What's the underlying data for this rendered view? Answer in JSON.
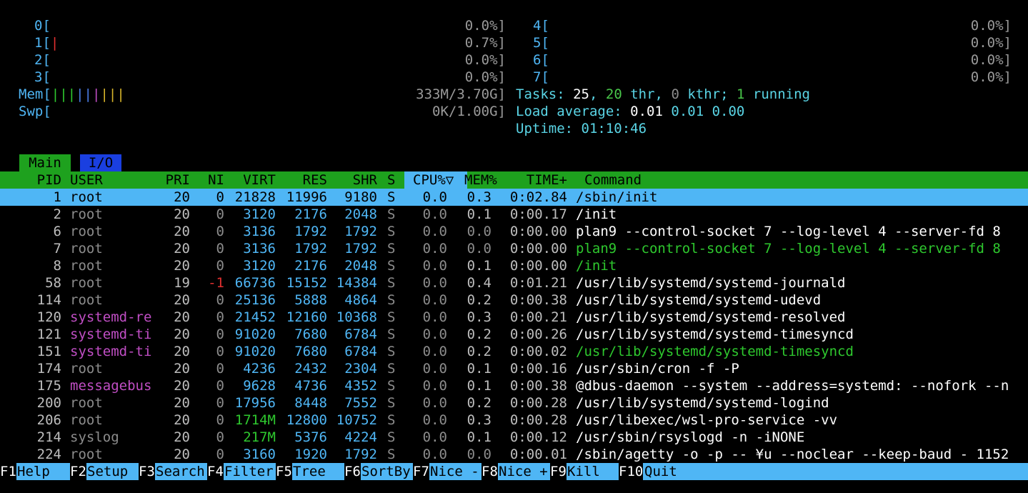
{
  "cpus": [
    {
      "id": "0",
      "value": "0.0%]"
    },
    {
      "id": "1",
      "value": "0.7%]"
    },
    {
      "id": "2",
      "value": "0.0%]"
    },
    {
      "id": "3",
      "value": "0.0%]"
    },
    {
      "id": "4",
      "value": "0.0%]"
    },
    {
      "id": "5",
      "value": "0.0%]"
    },
    {
      "id": "6",
      "value": "0.0%]"
    },
    {
      "id": "7",
      "value": "0.0%]"
    }
  ],
  "mem": {
    "label": "Mem",
    "value": "333M/3.70G]"
  },
  "swp": {
    "label": "Swp",
    "value": "0K/1.00G]"
  },
  "tasks": {
    "label": "Tasks:",
    "count": "25",
    "thr": "20",
    "thr_label": "thr,",
    "kthr": "0",
    "kthr_label": "kthr;",
    "running": "1",
    "running_label": "running"
  },
  "load": {
    "label": "Load average:",
    "v1": "0.01",
    "v2": "0.01",
    "v3": "0.00"
  },
  "uptime": {
    "label": "Uptime:",
    "value": "01:10:46"
  },
  "tabs": {
    "main": "Main",
    "io": "I/O"
  },
  "columns": {
    "pid": "PID",
    "user": "USER",
    "pri": "PRI",
    "ni": "NI",
    "virt": "VIRT",
    "res": "RES",
    "shr": "SHR",
    "s": "S",
    "cpu": "CPU%▽",
    "mem": "MEM%",
    "time": "TIME+",
    "command": "Command"
  },
  "processes": [
    {
      "pid": "1",
      "user": "root",
      "pri": "20",
      "ni": "0",
      "virt": "21828",
      "res": "11996",
      "shr": "9180",
      "s": "S",
      "cpu": "0.0",
      "mem": "0.3",
      "time": "0:02.84",
      "command": "/sbin/init"
    },
    {
      "pid": "2",
      "user": "root",
      "pri": "20",
      "ni": "0",
      "virt": "3120",
      "res": "2176",
      "shr": "2048",
      "s": "S",
      "cpu": "0.0",
      "mem": "0.1",
      "time": "0:00.17",
      "command": "/init"
    },
    {
      "pid": "6",
      "user": "root",
      "pri": "20",
      "ni": "0",
      "virt": "3136",
      "res": "1792",
      "shr": "1792",
      "s": "S",
      "cpu": "0.0",
      "mem": "0.0",
      "time": "0:00.00",
      "command": "plan9 --control-socket 7 --log-level 4 --server-fd 8"
    },
    {
      "pid": "7",
      "user": "root",
      "pri": "20",
      "ni": "0",
      "virt": "3136",
      "res": "1792",
      "shr": "1792",
      "s": "S",
      "cpu": "0.0",
      "mem": "0.0",
      "time": "0:00.00",
      "command": "plan9 --control-socket 7 --log-level 4 --server-fd 8"
    },
    {
      "pid": "8",
      "user": "root",
      "pri": "20",
      "ni": "0",
      "virt": "3120",
      "res": "2176",
      "shr": "2048",
      "s": "S",
      "cpu": "0.0",
      "mem": "0.1",
      "time": "0:00.00",
      "command": "/init"
    },
    {
      "pid": "58",
      "user": "root",
      "pri": "19",
      "ni": "-1",
      "virt": "66736",
      "res": "15152",
      "shr": "14384",
      "s": "S",
      "cpu": "0.0",
      "mem": "0.4",
      "time": "0:01.21",
      "command": "/usr/lib/systemd/systemd-journald"
    },
    {
      "pid": "114",
      "user": "root",
      "pri": "20",
      "ni": "0",
      "virt": "25136",
      "res": "5888",
      "shr": "4864",
      "s": "S",
      "cpu": "0.0",
      "mem": "0.2",
      "time": "0:00.38",
      "command": "/usr/lib/systemd/systemd-udevd"
    },
    {
      "pid": "120",
      "user": "systemd-re",
      "pri": "20",
      "ni": "0",
      "virt": "21452",
      "res": "12160",
      "shr": "10368",
      "s": "S",
      "cpu": "0.0",
      "mem": "0.3",
      "time": "0:00.21",
      "command": "/usr/lib/systemd/systemd-resolved"
    },
    {
      "pid": "121",
      "user": "systemd-ti",
      "pri": "20",
      "ni": "0",
      "virt": "91020",
      "res": "7680",
      "shr": "6784",
      "s": "S",
      "cpu": "0.0",
      "mem": "0.2",
      "time": "0:00.26",
      "command": "/usr/lib/systemd/systemd-timesyncd"
    },
    {
      "pid": "151",
      "user": "systemd-ti",
      "pri": "20",
      "ni": "0",
      "virt": "91020",
      "res": "7680",
      "shr": "6784",
      "s": "S",
      "cpu": "0.0",
      "mem": "0.2",
      "time": "0:00.02",
      "command": "/usr/lib/systemd/systemd-timesyncd"
    },
    {
      "pid": "174",
      "user": "root",
      "pri": "20",
      "ni": "0",
      "virt": "4236",
      "res": "2432",
      "shr": "2304",
      "s": "S",
      "cpu": "0.0",
      "mem": "0.1",
      "time": "0:00.16",
      "command": "/usr/sbin/cron -f -P"
    },
    {
      "pid": "175",
      "user": "messagebus",
      "pri": "20",
      "ni": "0",
      "virt": "9628",
      "res": "4736",
      "shr": "4352",
      "s": "S",
      "cpu": "0.0",
      "mem": "0.1",
      "time": "0:00.38",
      "command": "@dbus-daemon --system --address=systemd: --nofork --n"
    },
    {
      "pid": "200",
      "user": "root",
      "pri": "20",
      "ni": "0",
      "virt": "17956",
      "res": "8448",
      "shr": "7552",
      "s": "S",
      "cpu": "0.0",
      "mem": "0.2",
      "time": "0:00.28",
      "command": "/usr/lib/systemd/systemd-logind"
    },
    {
      "pid": "206",
      "user": "root",
      "pri": "20",
      "ni": "0",
      "virt": "1714M",
      "res": "12800",
      "shr": "10752",
      "s": "S",
      "cpu": "0.0",
      "mem": "0.3",
      "time": "0:00.28",
      "command": "/usr/libexec/wsl-pro-service -vv"
    },
    {
      "pid": "214",
      "user": "syslog",
      "pri": "20",
      "ni": "0",
      "virt": "217M",
      "res": "5376",
      "shr": "4224",
      "s": "S",
      "cpu": "0.0",
      "mem": "0.1",
      "time": "0:00.12",
      "command": "/usr/sbin/rsyslogd -n -iNONE"
    },
    {
      "pid": "224",
      "user": "root",
      "pri": "20",
      "ni": "0",
      "virt": "3160",
      "res": "1920",
      "shr": "1792",
      "s": "S",
      "cpu": "0.0",
      "mem": "0.0",
      "time": "0:00.01",
      "command": "/sbin/agetty -o -p -- ¥u --noclear --keep-baud - 1152"
    }
  ],
  "footer": [
    {
      "key": "F1",
      "label": "Help  "
    },
    {
      "key": "F2",
      "label": "Setup "
    },
    {
      "key": "F3",
      "label": "Search"
    },
    {
      "key": "F4",
      "label": "Filter"
    },
    {
      "key": "F5",
      "label": "Tree  "
    },
    {
      "key": "F6",
      "label": "SortBy"
    },
    {
      "key": "F7",
      "label": "Nice -"
    },
    {
      "key": "F8",
      "label": "Nice +"
    },
    {
      "key": "F9",
      "label": "Kill  "
    },
    {
      "key": "F10",
      "label": "Quit"
    }
  ],
  "colors": {
    "accent_cyan": "#4fb6f5",
    "header_green": "#1ea11e",
    "tab_blue": "#1a3fe0"
  }
}
